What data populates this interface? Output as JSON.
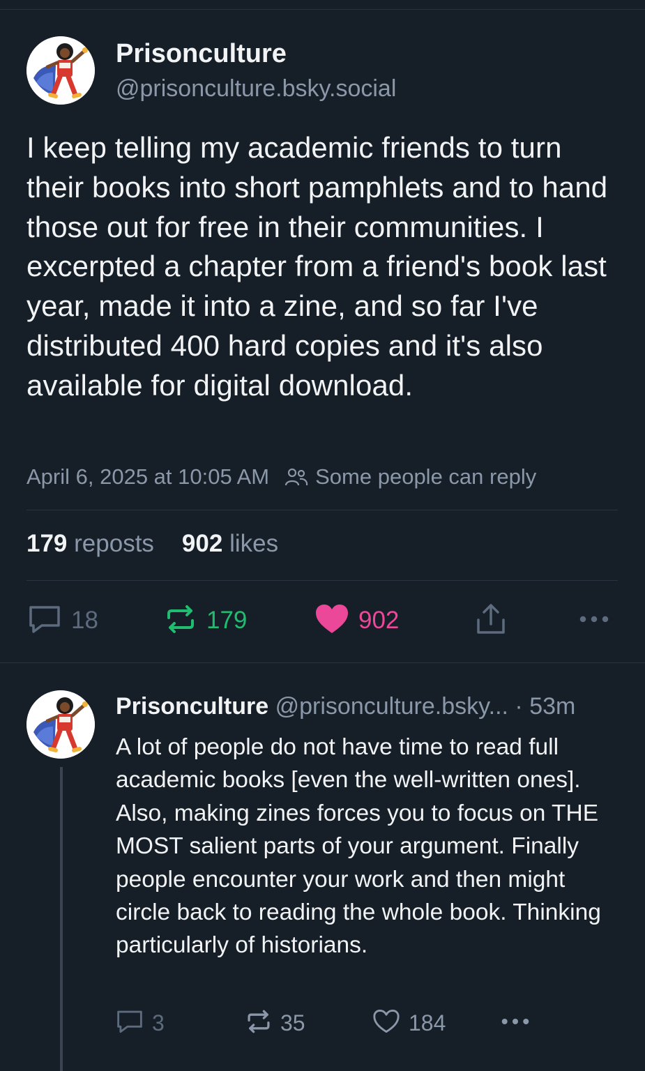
{
  "post": {
    "author_name": "Prisonculture",
    "author_handle": "@prisonculture.bsky.social",
    "text": "I keep telling my academic friends to turn their books into short pamphlets and to hand those out for free in their communities. I excerpted a chapter from a friend's book last year, made it into a zine, and so far I've distributed 400 hard copies and it's also available for digital download.",
    "timestamp": "April 6, 2025 at 10:05 AM",
    "reply_setting": "Some people can reply",
    "reply_setting_icon": "people-icon",
    "reposts_count": "179",
    "reposts_label": "reposts",
    "likes_count": "902",
    "likes_label": "likes",
    "actions": {
      "replies": "18",
      "reposts": "179",
      "likes": "902"
    }
  },
  "reply": {
    "author_name": "Prisonculture",
    "author_handle": "@prisonculture.bsky...",
    "separator": "·",
    "time_ago": "53m",
    "text": "A lot of people do not have time to read full academic books [even the well-written ones]. Also, making zines forces you to focus on THE MOST salient parts of your argument. Finally people encounter your work and then might circle back to reading the whole book. Thinking particularly of historians.",
    "actions": {
      "replies": "3",
      "reposts": "35",
      "likes": "184"
    }
  },
  "colors": {
    "background": "#161e27",
    "muted": "#8b98a9",
    "repost_active": "#20bc6f",
    "like_active": "#ec4899",
    "divider": "#2a3440"
  }
}
